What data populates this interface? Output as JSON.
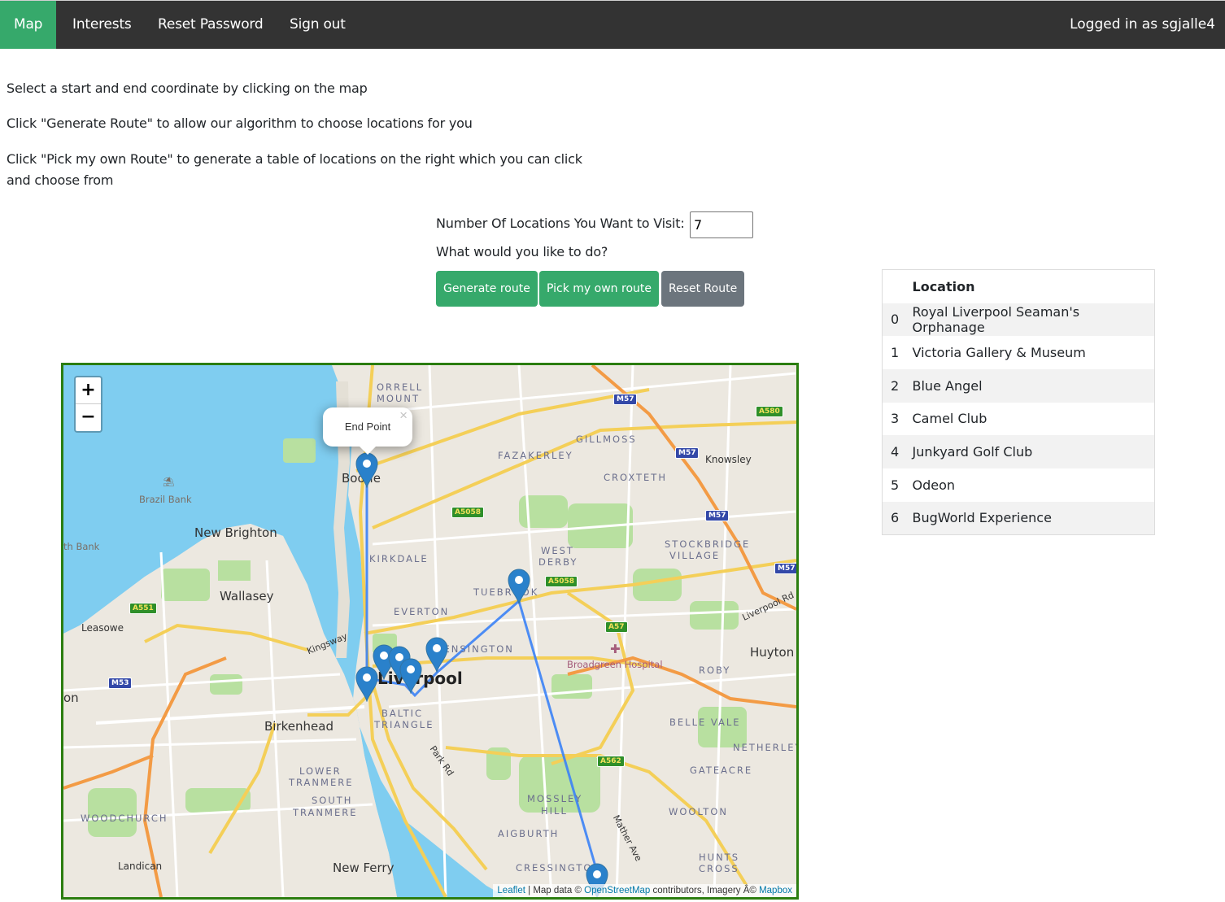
{
  "navbar": {
    "items": [
      {
        "label": "Map",
        "active": true
      },
      {
        "label": "Interests",
        "active": false
      },
      {
        "label": "Reset Password",
        "active": false
      },
      {
        "label": "Sign out",
        "active": false
      }
    ],
    "user_text": "Logged in as sgjalle4"
  },
  "instructions": {
    "line1": "Select a start and end coordinate by clicking on the map",
    "line2": "Click \"Generate Route\" to allow our algorithm to choose locations for you",
    "line3a": "Click \"Pick my own Route\" to generate a table of locations on the right which you can click",
    "line3b": "and choose from"
  },
  "form": {
    "num_locations_label": "Number Of Locations You Want to Visit:",
    "num_locations_value": "7",
    "question": "What would you like to do?",
    "buttons": {
      "generate": "Generate route",
      "pick_own": "Pick my own route",
      "reset": "Reset Route"
    }
  },
  "colors": {
    "accent": "#36a96b",
    "navbar": "#333333",
    "secondary": "#6c757d",
    "map_border": "#2b7d0f",
    "route": "#3b82f6",
    "marker": "#2a81cb"
  },
  "locations_table": {
    "header": {
      "index": "",
      "location": "Location"
    },
    "rows": [
      {
        "index": "0",
        "name": "Royal Liverpool Seaman's Orphanage"
      },
      {
        "index": "1",
        "name": "Victoria Gallery & Museum"
      },
      {
        "index": "2",
        "name": "Blue Angel"
      },
      {
        "index": "3",
        "name": "Camel Club"
      },
      {
        "index": "4",
        "name": "Junkyard Golf Club"
      },
      {
        "index": "5",
        "name": "Odeon"
      },
      {
        "index": "6",
        "name": "BugWorld Experience"
      }
    ]
  },
  "map": {
    "zoom_in": "+",
    "zoom_out": "−",
    "popup_text": "End Point",
    "popup_close": "×",
    "attribution": {
      "leaflet": "Leaflet",
      "sep": " | Map data © ",
      "osm": "OpenStreetMap",
      "middle": " contributors, Imagery Â© ",
      "mapbox": "Mapbox"
    },
    "labels": {
      "orrell1": "ORRELL",
      "orrell2": "MOUNT",
      "brazil_bank": "Brazil Bank",
      "bootle": "Bootle",
      "fazakerley": "FAZAKERLEY",
      "gillmoss": "GILLMOSS",
      "croxteth": "CROXTETH",
      "knowsley": "Knowsley",
      "new_brighton": "New Brighton",
      "th_bank": "th Bank",
      "kirkdale": "KIRKDALE",
      "west1": "WEST",
      "west2": "DERBY",
      "stock1": "STOCKBRIDGE",
      "stock2": "VILLAGE",
      "wallasey": "Wallasey",
      "tuebrook": "TUEBROOK",
      "everton": "EVERTON",
      "liverpool_rd": "Liverpool Rd",
      "leasowe": "Leasowe",
      "kingsway": "Kingsway",
      "kensington": "KENSINGTON",
      "broadgreen": "Broadgreen Hospital",
      "huyton": "Huyton",
      "roby": "ROBY",
      "liverpool": "Liverpool",
      "on": "on",
      "baltic1": "BALTIC",
      "baltic2": "TRIANGLE",
      "birkenhead": "Birkenhead",
      "belle_vale": "BELLE VALE",
      "netherley": "NETHERLEY",
      "park_rd": "Park Rd",
      "gateacre": "GATEACRE",
      "lower1": "LOWER",
      "lower2": "TRANMERE",
      "south1": "SOUTH",
      "south2": "TRANMERE",
      "mossley1": "MOSSLEY",
      "mossley2": "HILL",
      "woodchurch": "WOODCHURCH",
      "woolton": "WOOLTON",
      "mather_ave": "Mather Ave",
      "aigburth": "AIGBURTH",
      "hunts1": "HUNTS",
      "hunts2": "CROSS",
      "landican": "Landican",
      "new_ferry": "New Ferry",
      "cressington": "CRESSINGTON"
    },
    "shields": {
      "m57": "M57",
      "a580": "A580",
      "a5058": "A5058",
      "a551": "A551",
      "a57": "A57",
      "m53": "M53",
      "a562": "A562"
    }
  }
}
